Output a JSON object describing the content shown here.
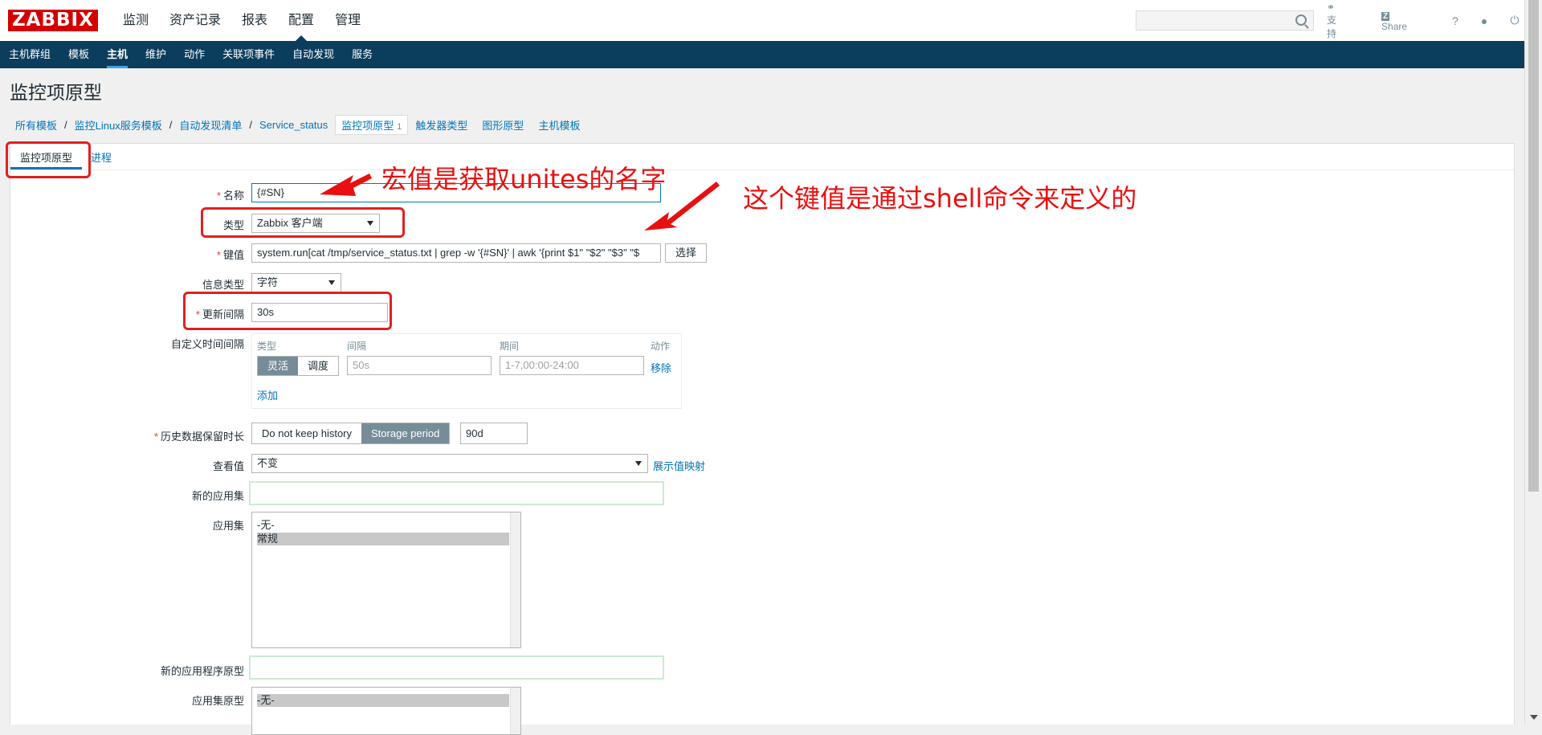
{
  "header": {
    "logo": "ZABBIX",
    "menu": [
      "监测",
      "资产记录",
      "报表",
      "配置",
      "管理"
    ],
    "active_menu": 3,
    "links": {
      "support": "支持",
      "share": "Share",
      "help": "?"
    }
  },
  "subnav": {
    "items": [
      "主机群组",
      "模板",
      "主机",
      "维护",
      "动作",
      "关联项事件",
      "自动发现",
      "服务"
    ],
    "active": 2
  },
  "page": {
    "title": "监控项原型"
  },
  "breadcrumbs": {
    "items": [
      "所有模板",
      "监控Linux服务模板",
      "自动发现清单",
      "Service_status"
    ],
    "current": "监控项原型",
    "current_count": "1",
    "after": [
      "触发器类型",
      "图形原型",
      "主机模板"
    ]
  },
  "tabs": [
    "监控项原型",
    "进程"
  ],
  "form": {
    "name_label": "名称",
    "name_value": "{#SN}",
    "type_label": "类型",
    "type_value": "Zabbix 客户端",
    "key_label": "键值",
    "key_value": "system.run[cat /tmp/service_status.txt  | grep -w '{#SN}' | awk '{print $1\" \"$2\" \"$3\" \"$",
    "select_button": "选择",
    "info_type_label": "信息类型",
    "info_type_value": "字符",
    "interval_label": "更新间隔",
    "interval_value": "30s",
    "custom_interval_label": "自定义时间间隔",
    "custom_interval": {
      "headers": [
        "类型",
        "间隔",
        "期间",
        "动作"
      ],
      "mode_flexible": "灵活",
      "mode_scheduling": "调度",
      "interval_placeholder": "50s",
      "period_placeholder": "1-7,00:00-24:00",
      "remove": "移除",
      "add": "添加"
    },
    "history_label": "历史数据保留时长",
    "history_no_keep": "Do not keep history",
    "history_storage": "Storage period",
    "history_value": "90d",
    "show_value_label": "查看值",
    "show_value_value": "不变",
    "show_value_mapping": "展示值映射",
    "new_app_label": "新的应用集",
    "new_app_value": "",
    "apps_label": "应用集",
    "apps": [
      "-无-",
      "常规"
    ],
    "new_app_proto_label": "新的应用程序原型",
    "new_app_proto_value": "",
    "app_proto_label": "应用集原型",
    "app_protos": [
      "-无-"
    ]
  },
  "annotations": {
    "note1": "宏值是获取unites的名字",
    "note2": "这个键值是通过shell命令来定义的",
    "color": "#e02020"
  }
}
